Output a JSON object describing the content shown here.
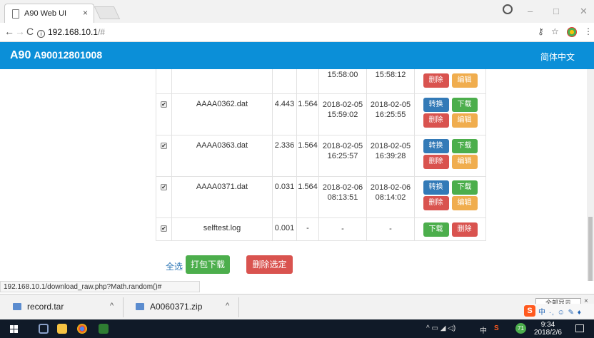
{
  "browser": {
    "tab_title": "A90 Web UI",
    "tab_close": "×",
    "url_host": "192.168.10.1",
    "url_rest": "/#",
    "status_url": "192.168.10.1/download_raw.php?Math.random()#"
  },
  "app": {
    "title": "A90",
    "serial": "A90012801008",
    "language": "简体中文"
  },
  "partial_row": {
    "time_a": "15:58:00",
    "time_b": "15:58:12",
    "delete": "删除",
    "edit": "编辑"
  },
  "rows": [
    {
      "name": "AAAA0362.dat",
      "size": "4.443",
      "ver": "1.564",
      "start_date": "2018-02-05",
      "start_time": "15:59:02",
      "end_date": "2018-02-05",
      "end_time": "16:25:55",
      "convert": "转换",
      "download": "下载",
      "delete": "删除",
      "edit": "编辑"
    },
    {
      "name": "AAAA0363.dat",
      "size": "2.336",
      "ver": "1.564",
      "start_date": "2018-02-05",
      "start_time": "16:25:57",
      "end_date": "2018-02-05",
      "end_time": "16:39:28",
      "convert": "转换",
      "download": "下载",
      "delete": "删除",
      "edit": "编辑"
    },
    {
      "name": "AAAA0371.dat",
      "size": "0.031",
      "ver": "1.564",
      "start_date": "2018-02-06",
      "start_time": "08:13:51",
      "end_date": "2018-02-06",
      "end_time": "08:14:02",
      "convert": "转换",
      "download": "下载",
      "delete": "删除",
      "edit": "编辑"
    }
  ],
  "log_row": {
    "name": "selftest.log",
    "size": "0.001",
    "ver": "-",
    "start": "-",
    "end": "-",
    "download": "下载",
    "delete": "删除"
  },
  "actions": {
    "select_all": "全选",
    "pack_download": "打包下载",
    "delete_selected": "删除选定"
  },
  "downloads": [
    {
      "name": "record.tar"
    },
    {
      "name": "A0060371.zip"
    }
  ],
  "shelf": {
    "show_all": "全部显示",
    "close": "×"
  },
  "taskbar": {
    "time": "9:34",
    "date": "2018/2/6",
    "badge": "71",
    "ime_lang": "中"
  },
  "colors": {
    "header": "#0b8fd8",
    "blue": "#337ab7",
    "green": "#4cae4c",
    "red": "#d9534f",
    "orange": "#f0ad4e"
  }
}
